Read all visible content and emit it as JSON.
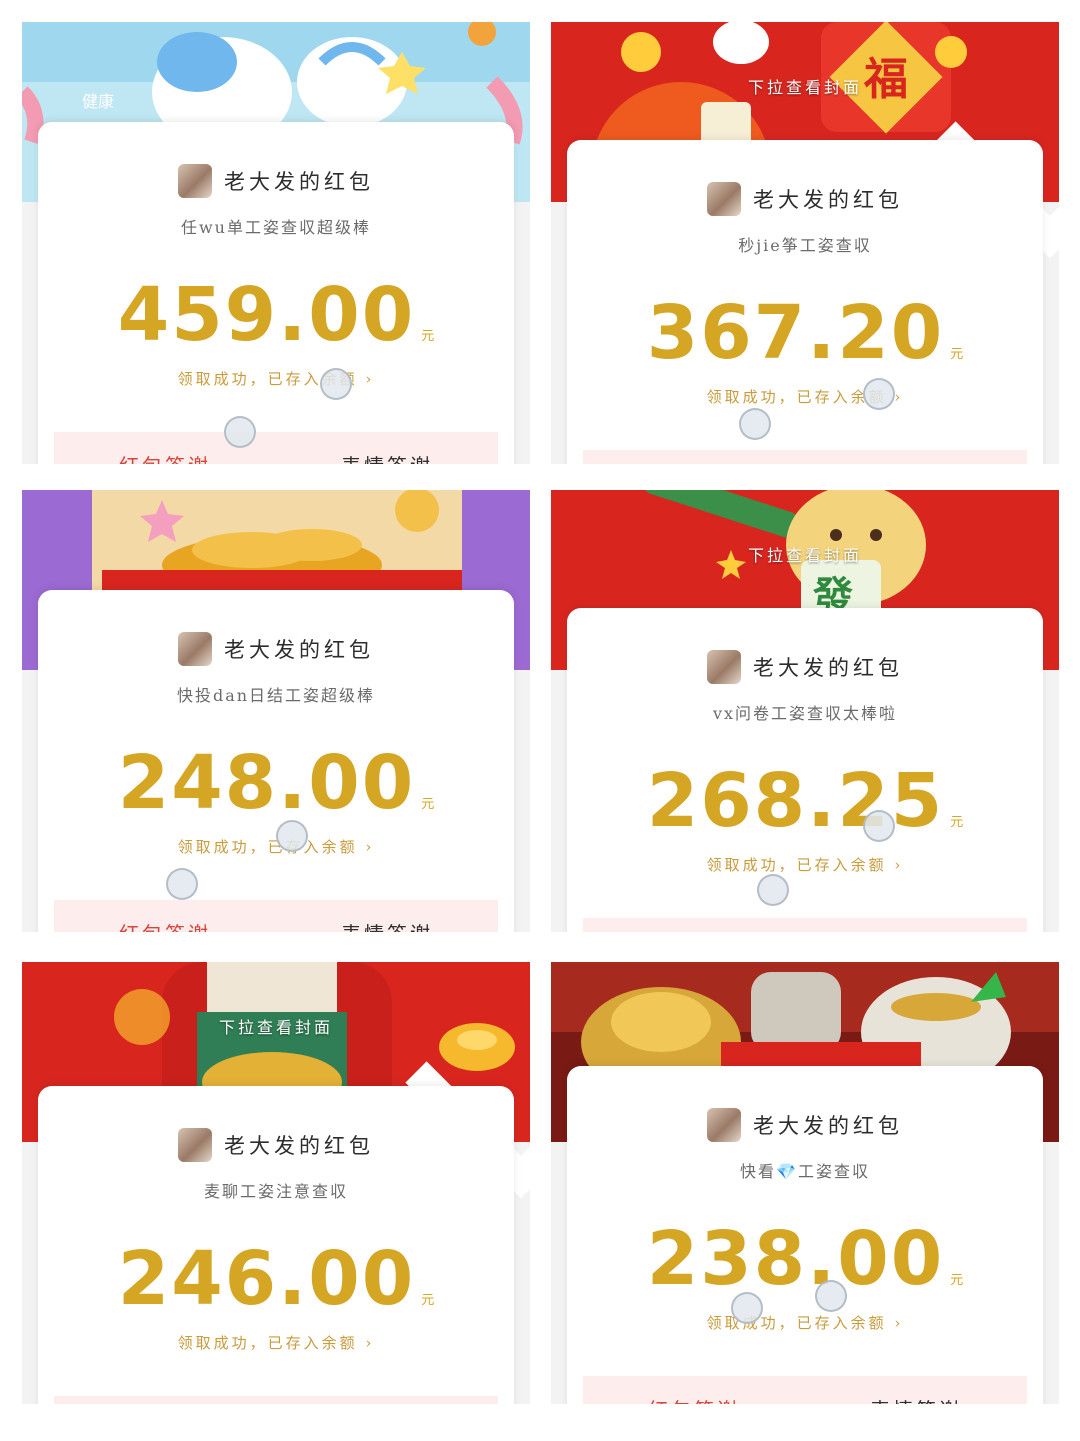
{
  "cover_hint": "下拉查看封面",
  "sender_name": "老大发的红包",
  "unit": "元",
  "status_text": "领取成功，已存入余额",
  "status_chevron": "›",
  "thanks_red_packet": "红包答谢",
  "thanks_sticker": "表情答谢",
  "cover_art": {
    "panel1": "unicorn",
    "panel2": "fortune-red",
    "panel3": "gold-coins-purple",
    "panel4": "cat-fa-red",
    "panel5": "god-of-wealth",
    "panel6": "gold-coins-warrior"
  },
  "colors": {
    "amount": "#d5a524",
    "status": "#c99b3a",
    "thanks_red": "#d6453b",
    "thanks_bg": "#fdeeed",
    "cover_red": "#d8261f",
    "cover_purple": "#9b6ad2"
  },
  "packets": [
    {
      "greeting": "任wu单工姿查収超级棒",
      "amount": "459.00"
    },
    {
      "greeting": "秒jie筝工姿查収",
      "amount": "367.20"
    },
    {
      "greeting": "快投dan日结工姿超级棒",
      "amount": "248.00"
    },
    {
      "greeting": "vx问卷工姿查収太棒啦",
      "amount": "268.25"
    },
    {
      "greeting": "麦聊工姿注意查収",
      "amount": "246.00"
    },
    {
      "greeting": "快看💎工姿查収",
      "amount": "238.00"
    }
  ]
}
